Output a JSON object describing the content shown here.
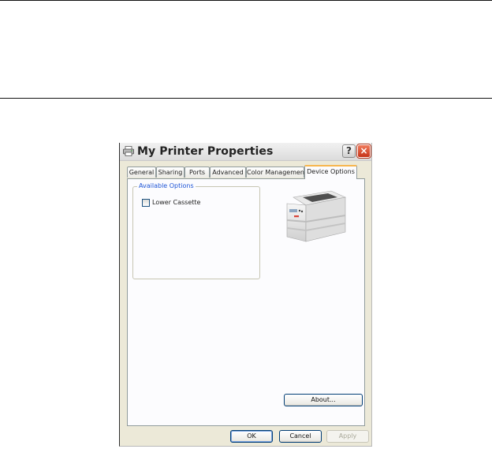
{
  "window": {
    "title": "My Printer Properties",
    "help_label": "?",
    "close_label": "×"
  },
  "tabs": [
    {
      "label": "General"
    },
    {
      "label": "Sharing"
    },
    {
      "label": "Ports"
    },
    {
      "label": "Advanced"
    },
    {
      "label": "Color Management"
    },
    {
      "label": "Device Options",
      "active": true
    }
  ],
  "options": {
    "group_label": "Available Options",
    "items": [
      {
        "label": "Lower Cassette",
        "checked": false
      }
    ]
  },
  "buttons": {
    "about": "About...",
    "ok": "OK",
    "cancel": "Cancel",
    "apply": "Apply"
  },
  "icons": {
    "title": "printer-icon",
    "device": "printer-image"
  },
  "colors": {
    "legend_text": "#1e55d6",
    "close_button": "#c6341a",
    "active_tab_accent": "#f7b64e"
  }
}
